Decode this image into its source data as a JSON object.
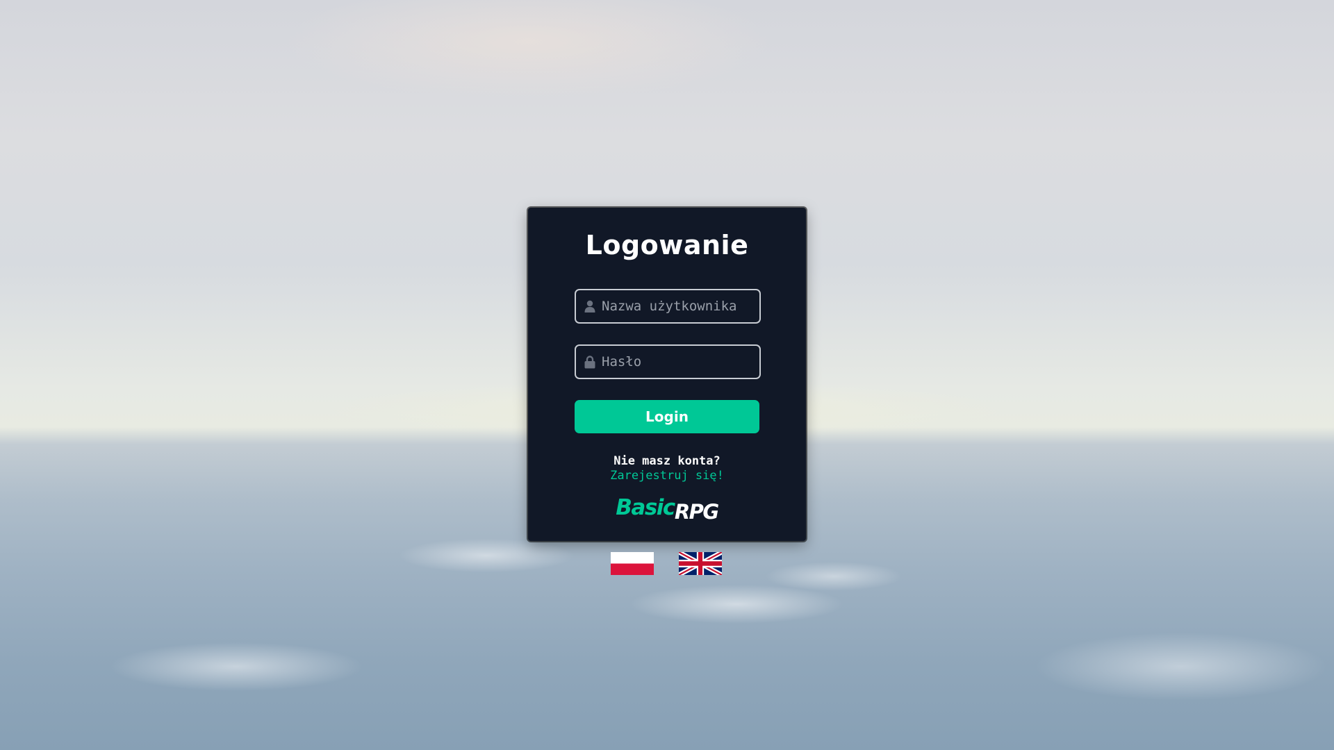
{
  "login": {
    "title": "Logowanie",
    "username_placeholder": "Nazwa użytkownika",
    "password_placeholder": "Hasło",
    "login_button": "Login",
    "no_account_text": "Nie masz konta?",
    "register_link": "Zarejestruj się!"
  },
  "logo": {
    "basic": "Basic",
    "rpg": "RPG"
  },
  "icons": {
    "username": "user-icon",
    "password": "lock-icon"
  },
  "languages": [
    {
      "code": "pl",
      "flag": "poland-flag"
    },
    {
      "code": "en",
      "flag": "uk-flag"
    }
  ],
  "colors": {
    "card_background": "#111827",
    "accent": "#00c896",
    "text": "#ffffff",
    "placeholder": "#9aa0aa",
    "input_border": "#c8ccd3"
  }
}
